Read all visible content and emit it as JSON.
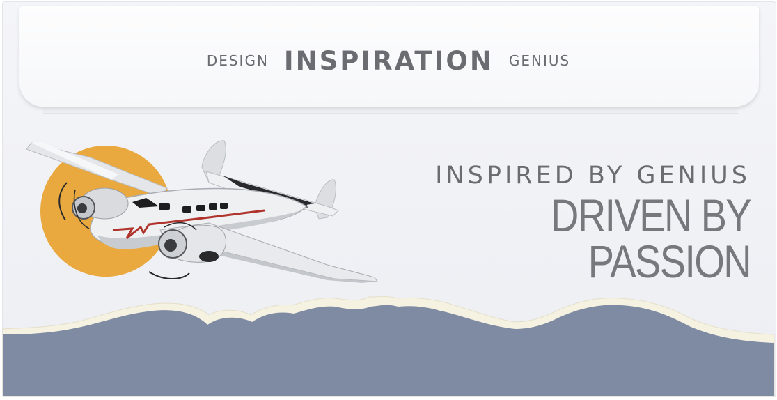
{
  "flap": {
    "left_word": "DESIGN",
    "center_word": "INSPIRATION",
    "right_word": "GENIUS"
  },
  "tagline": {
    "line1": "INSPIRED BY GENIUS",
    "line2": "DRIVEN BY PASSION"
  },
  "colors": {
    "sun": "#e9a93f",
    "hills": "#7e8ba3",
    "hill_edge": "#f6f2e2",
    "text": "#6a6c71"
  },
  "icons": {
    "illustration": "vintage-airplane-icon",
    "sun": "sun-icon"
  }
}
